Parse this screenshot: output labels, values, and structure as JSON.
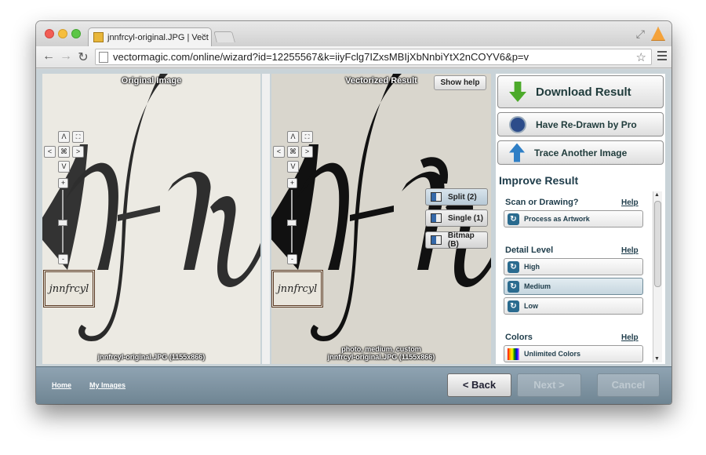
{
  "browser": {
    "tab_title": "jnnfrcyl-original.JPG | Vect",
    "tab_close": "×",
    "url": "vectormagic.com/online/wizard?id=12255567&k=iiyFclg7IZxsMBIjXbNnbiYtX2nCOYV6&p=v",
    "back": "←",
    "forward": "→",
    "reload": "↻",
    "star": "☆",
    "resize_glyph": "⤢"
  },
  "left_panel": {
    "title": "Original Image",
    "caption": "jnnfrcyl-original.JPG  (1155x866)",
    "thumbnail_text": "jnnfrcyl"
  },
  "right_panel": {
    "title": "Vectorized Result",
    "caption_line1": "photo, medium, custom",
    "caption_line2": "jnnfrcyl-original.JPG  (1155x866)",
    "thumbnail_text": "jnnfrcyl"
  },
  "zoom": {
    "up": "Λ",
    "down": "V",
    "left": "<",
    "right": ">",
    "fit": "⌘",
    "full": "⛶",
    "plus": "+",
    "minus": "-"
  },
  "show_help": "Show help",
  "view_modes": [
    {
      "label": "Split (2)",
      "active": true
    },
    {
      "label": "Single (1)",
      "active": false
    },
    {
      "label": "Bitmap (B)",
      "active": false
    }
  ],
  "actions": {
    "download": "Download Result",
    "redraw": "Have Re-Drawn by Pro",
    "trace": "Trace Another Image"
  },
  "improve": {
    "title": "Improve Result",
    "sections": [
      {
        "label": "Scan or Drawing?",
        "help": "Help",
        "options": [
          {
            "label": "Process as Artwork",
            "selected": false
          }
        ]
      },
      {
        "label": "Detail Level",
        "help": "Help",
        "options": [
          {
            "label": "High",
            "selected": false
          },
          {
            "label": "Medium",
            "selected": true
          },
          {
            "label": "Low",
            "selected": false
          }
        ]
      },
      {
        "label": "Colors",
        "help": "Help",
        "options": [
          {
            "label": "Unlimited Colors",
            "selected": false
          }
        ]
      }
    ]
  },
  "footer": {
    "home": "Home",
    "my_images": "My Images",
    "back": "< Back",
    "next": "Next >",
    "cancel": "Cancel"
  }
}
